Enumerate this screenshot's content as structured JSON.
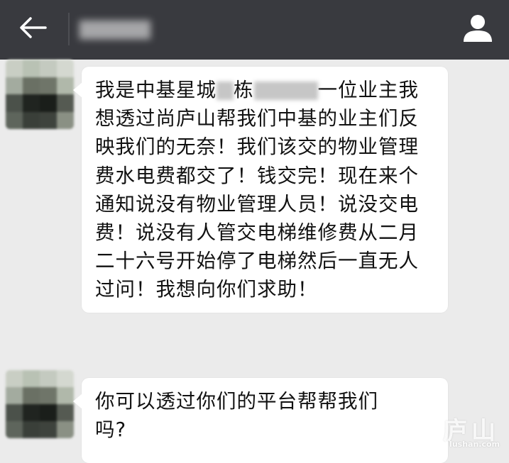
{
  "header": {
    "title": "▇▇▇▇▇",
    "back_icon": "arrow-left-icon",
    "profile_icon": "person-icon",
    "bar_color": "#393a3f"
  },
  "messages": [
    {
      "sender": "other",
      "text_parts": [
        "我是中基星城",
        "栋",
        "一位业主我想透过尚庐山帮我们中基的业主们反映我们的无奈！我们该交的物业管理费水电费都交了！钱交完！现在来个通知说没有物业管理人员！说没交电费！说没有人管交电梯维修费从二月二十六号开始停了电梯然后一直无人过问！我想向你们求助！"
      ]
    },
    {
      "sender": "other",
      "text": "你可以透过你们的平台帮帮我们吗?"
    }
  ],
  "watermark": {
    "big": "庐山",
    "small": "lushan.com"
  },
  "colors": {
    "background": "#ebebeb",
    "bubble": "#ffffff",
    "text": "#111111"
  }
}
